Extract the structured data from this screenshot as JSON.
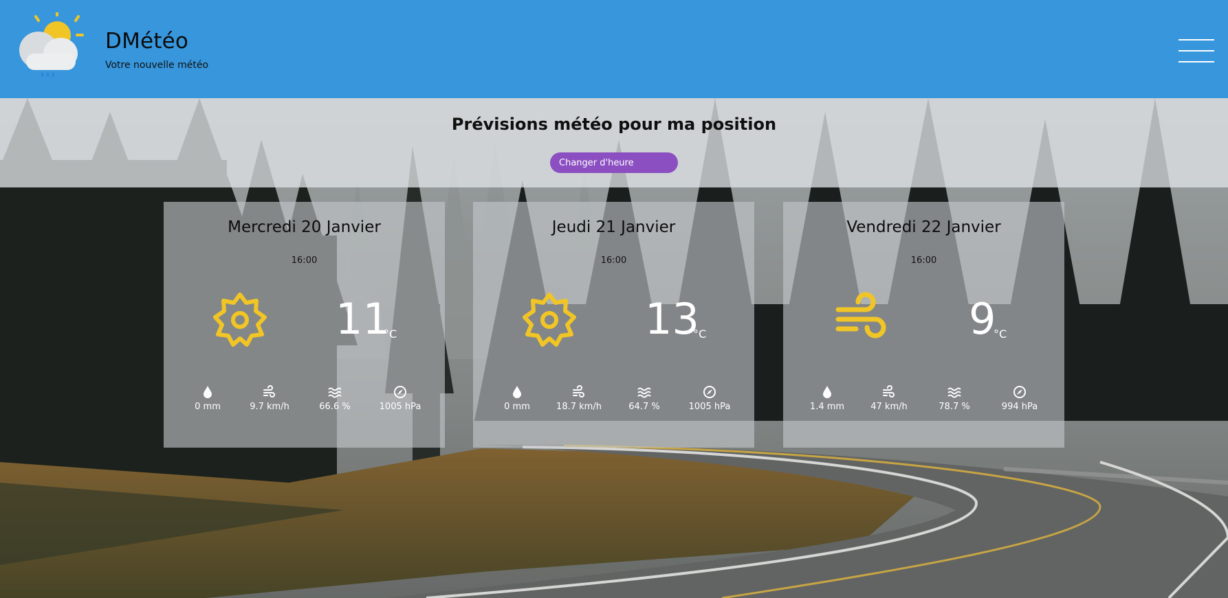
{
  "app": {
    "title": "DMétéo",
    "subtitle": "Votre nouvelle météo"
  },
  "header": {
    "logo_icon": "sun-cloud-rain-icon",
    "menu_icon": "hamburger-icon"
  },
  "main": {
    "title": "Prévisions météo pour ma position",
    "change_hour_label": "Changer d'heure",
    "button_color": "#8b4fc2",
    "header_color": "#3897dc",
    "accent_icon_color": "#f2c526"
  },
  "forecasts": [
    {
      "day": "Mercredi 20 Janvier",
      "hour": "16:00",
      "condition_icon": "sun-icon",
      "temperature": "11",
      "unit": "°C",
      "rain": "0 mm",
      "wind": "9.7 km/h",
      "humidity": "66.6 %",
      "pressure": "1005 hPa"
    },
    {
      "day": "Jeudi 21 Janvier",
      "hour": "16:00",
      "condition_icon": "sun-icon",
      "temperature": "13",
      "unit": "°C",
      "rain": "0 mm",
      "wind": "18.7 km/h",
      "humidity": "64.7 %",
      "pressure": "1005 hPa"
    },
    {
      "day": "Vendredi 22 Janvier",
      "hour": "16:00",
      "condition_icon": "wind-icon",
      "temperature": "9",
      "unit": "°C",
      "rain": "1.4 mm",
      "wind": "47 km/h",
      "humidity": "78.7 %",
      "pressure": "994 hPa"
    }
  ]
}
